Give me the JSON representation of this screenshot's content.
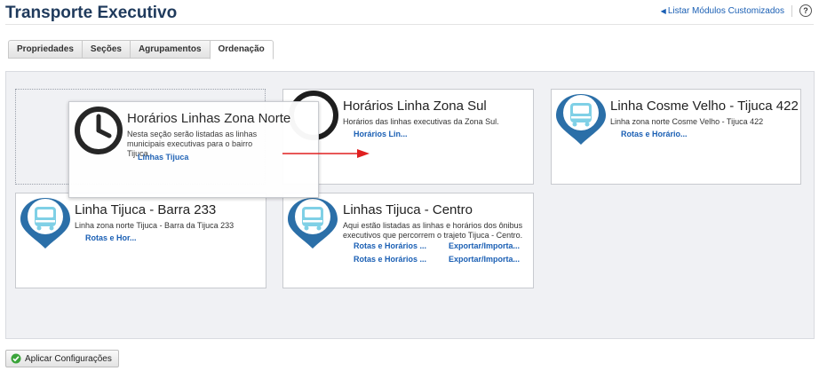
{
  "page": {
    "title": "Transporte Executivo"
  },
  "top_links": {
    "list_modules": "Listar Módulos Customizados",
    "help_glyph": "?"
  },
  "tabs": [
    {
      "label": "Propriedades",
      "active": false
    },
    {
      "label": "Seções",
      "active": false
    },
    {
      "label": "Agrupamentos",
      "active": false
    },
    {
      "label": "Ordenação",
      "active": true
    }
  ],
  "cards": {
    "norte": {
      "title": "Horários Linhas Zona Norte",
      "desc": "Nesta seção serão listadas as linhas municipais executivas para o bairro Tijuca.",
      "links": [
        "Linhas Tijuca"
      ],
      "icon": "clock-icon"
    },
    "sul": {
      "title": "Horários Linha Zona Sul",
      "desc": "Horários das linhas executivas da Zona Sul.",
      "links": [
        "Horários Lin..."
      ],
      "icon": "clock-icon"
    },
    "cosme": {
      "title": "Linha Cosme Velho - Tijuca 422",
      "desc": "Linha zona norte Cosme Velho - Tijuca 422",
      "links": [
        "Rotas e Horário..."
      ],
      "icon": "bus-pin-icon"
    },
    "barra": {
      "title": "Linha Tijuca - Barra 233",
      "desc": "Linha zona norte Tijuca - Barra da Tijuca 233",
      "links": [
        "Rotas e Hor..."
      ],
      "icon": "bus-pin-icon"
    },
    "centro": {
      "title": "Linhas Tijuca - Centro",
      "desc": "Aqui estão listadas as linhas e horários dos ônibus executivos que percorrem o trajeto Tijuca - Centro.",
      "links": [
        "Rotas e Horários ...",
        "Exportar/Importa...",
        "Rotas e Horários ...",
        "Exportar/Importa..."
      ],
      "icon": "bus-pin-icon"
    }
  },
  "actions": {
    "apply": "Aplicar Configurações"
  },
  "colors": {
    "accent_link": "#1a5fb4",
    "title": "#1f3a5c",
    "pin_blue": "#2b6fa8",
    "bus_fill": "#7fd0e6",
    "drag_arrow": "#e02020",
    "apply_icon": "#3aa43a"
  }
}
